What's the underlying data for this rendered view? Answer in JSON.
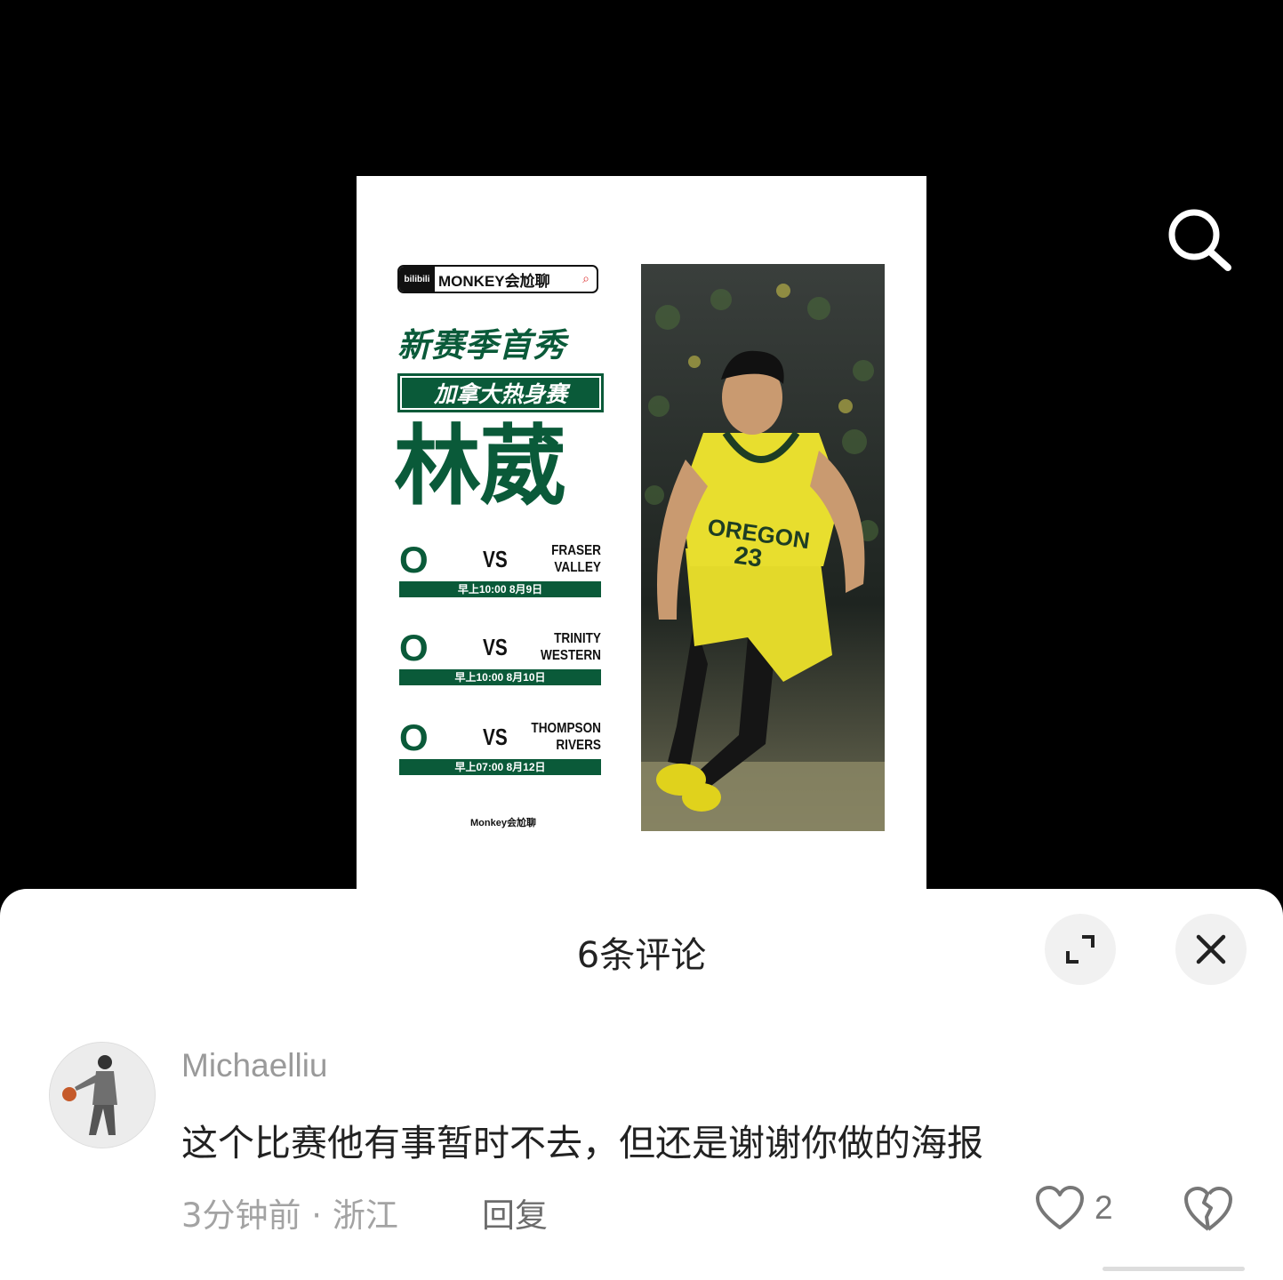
{
  "poster": {
    "brand_logo": "bilibili",
    "brand_name": "MONKEY会尬聊",
    "headline": "新赛季首秀",
    "subtitle": "加拿大热身赛",
    "player": "林葳",
    "games": [
      {
        "vs": "VS",
        "opponent_line1": "FRASER",
        "opponent_line2": "VALLEY",
        "time": "早上10:00 8月9日"
      },
      {
        "vs": "VS",
        "opponent_line1": "TRINITY",
        "opponent_line2": "WESTERN",
        "time": "早上10:00 8月10日"
      },
      {
        "vs": "VS",
        "opponent_line1": "THOMPSON",
        "opponent_line2": "RIVERS",
        "time": "早上07:00 8月12日"
      }
    ],
    "team_logo": "O",
    "jersey_text": "OREGON",
    "jersey_number": "23",
    "footer_logo": "Monkey会尬聊",
    "brand_color": "#0a5a39"
  },
  "sheet": {
    "title": "6条评论"
  },
  "comment": {
    "username": "Michaelliu",
    "text": "这个比赛他有事暂时不去，但还是谢谢你做的海报",
    "meta": "3分钟前 · 浙江",
    "reply_label": "回复",
    "likes": "2"
  },
  "icons": {
    "search": "search-icon",
    "expand": "expand-icon",
    "close": "close-icon",
    "like": "heart-icon",
    "dislike": "broken-heart-icon"
  }
}
